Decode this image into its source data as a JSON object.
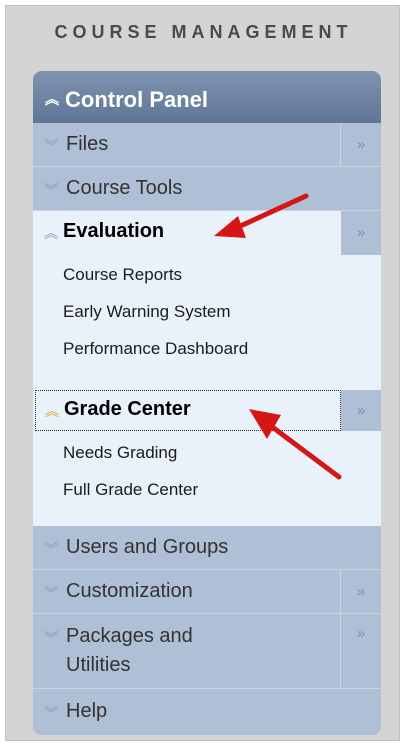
{
  "header": {
    "title": "COURSE MANAGEMENT"
  },
  "control_panel": {
    "title": "Control Panel"
  },
  "menu": {
    "files": "Files",
    "course_tools": "Course Tools",
    "evaluation": {
      "label": "Evaluation",
      "items": [
        "Course Reports",
        "Early Warning System",
        "Performance Dashboard"
      ]
    },
    "grade_center": {
      "label": "Grade Center",
      "items": [
        "Needs Grading",
        "Full Grade Center"
      ]
    },
    "users_groups": "Users and Groups",
    "customization": "Customization",
    "packages_line1": "Packages and",
    "packages_line2": "Utilities",
    "help": "Help"
  },
  "glyphs": {
    "collapse": "«",
    "expand": "»",
    "chev_up": "︽",
    "chev_down": "︾"
  }
}
